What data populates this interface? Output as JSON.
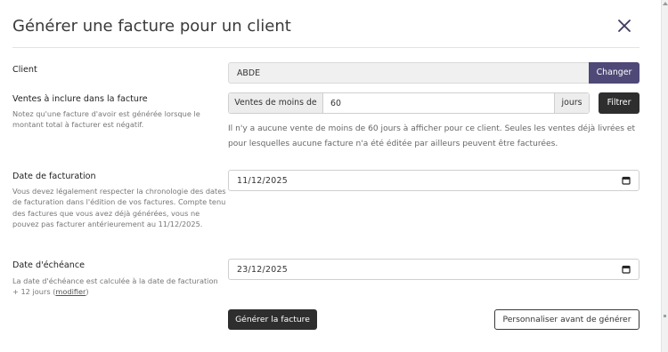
{
  "modal": {
    "title": "Générer une facture pour un client"
  },
  "client": {
    "label": "Client",
    "value": "ABDE",
    "change_button": "Changer"
  },
  "sales": {
    "label": "Ventes à inclure dans la facture",
    "hint": "Notez qu'une facture d'avoir est générée lorsque le montant total à facturer est négatif.",
    "prefix": "Ventes de moins de",
    "value": "60",
    "suffix": "jours",
    "filter_button": "Filtrer",
    "info_line1": "Il n'y a aucune vente de moins de 60 jours à afficher pour ce client. Seules les ventes déjà livrées et",
    "info_line2": "pour lesquelles aucune facture n'a été éditée par ailleurs peuvent être facturées."
  },
  "invoice_date": {
    "label": "Date de facturation",
    "hint": "Vous devez légalement respecter la chronologie des dates de facturation dans l'édition de vos factures. Compte tenu des factures que vous avez déjà générées, vous ne pouvez pas facturer antérieurement au 11/12/2025.",
    "value": "11/12/2025"
  },
  "due_date": {
    "label": "Date d'échéance",
    "hint_prefix": "La date d'échéance est calculée à la date de facturation + 12 jours (",
    "hint_link": "modifier",
    "hint_suffix": ")",
    "value": "23/12/2025"
  },
  "actions": {
    "generate": "Générer la facture",
    "customize": "Personnaliser avant de générer"
  },
  "colors": {
    "accent": "#4e4977",
    "dark_button": "#2e2e2e"
  },
  "icons": {
    "close": "close-icon",
    "calendar": "calendar-icon"
  }
}
